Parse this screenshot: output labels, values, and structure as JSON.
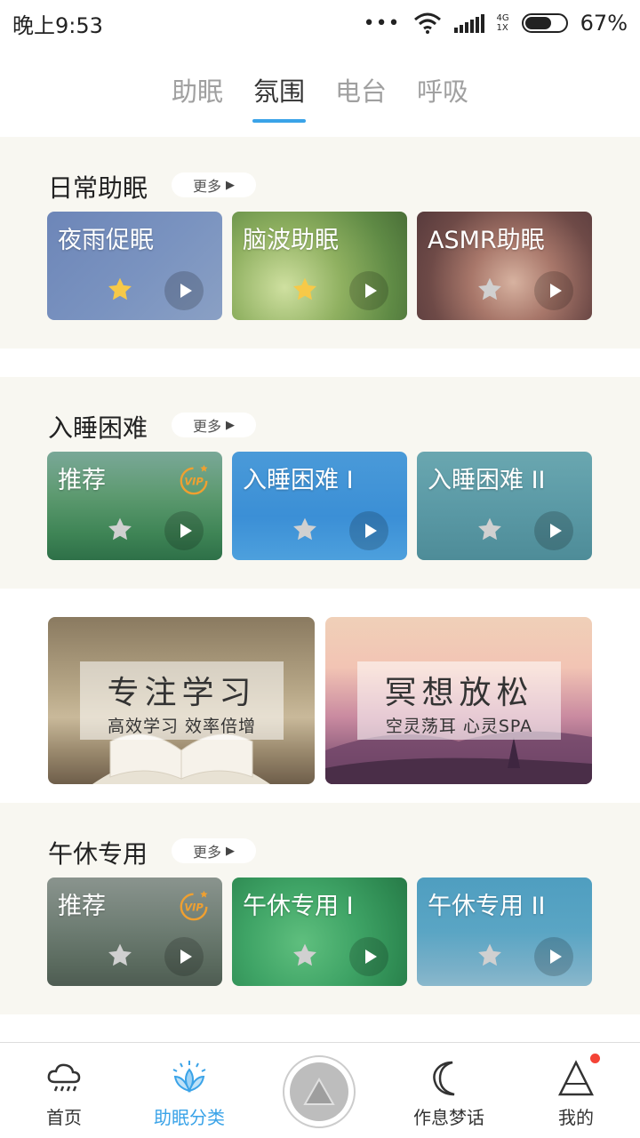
{
  "status_bar": {
    "time": "晚上9:53",
    "dots": "•••",
    "net_top": "4G",
    "net_bottom": "1X",
    "battery": "67%",
    "battery_level": 0.67
  },
  "tabs": [
    {
      "label": "助眠",
      "active": false
    },
    {
      "label": "氛围",
      "active": true
    },
    {
      "label": "电台",
      "active": false
    },
    {
      "label": "呼吸",
      "active": false
    }
  ],
  "more_label": "更多",
  "sections": [
    {
      "title": "日常助眠",
      "cards": [
        {
          "label": "夜雨促眠",
          "starred": true,
          "vip": false
        },
        {
          "label": "脑波助眠",
          "starred": true,
          "vip": false
        },
        {
          "label": "ASMR助眠",
          "starred": false,
          "vip": false
        }
      ]
    },
    {
      "title": "入睡困难",
      "cards": [
        {
          "label": "推荐",
          "starred": false,
          "vip": true
        },
        {
          "label": "入睡困难 I",
          "starred": false,
          "vip": false
        },
        {
          "label": "入睡困难 II",
          "starred": false,
          "vip": false
        }
      ]
    },
    {
      "title": "午休专用",
      "cards": [
        {
          "label": "推荐",
          "starred": false,
          "vip": true
        },
        {
          "label": "午休专用 I",
          "starred": false,
          "vip": false
        },
        {
          "label": "午休专用 II",
          "starred": false,
          "vip": false
        }
      ]
    }
  ],
  "banners": [
    {
      "title": "专注学习",
      "subtitle": "高效学习 效率倍增"
    },
    {
      "title": "冥想放松",
      "subtitle": "空灵荡耳 心灵SPA"
    }
  ],
  "bottom_nav": [
    {
      "label": "首页",
      "icon": "cloud-rain-icon",
      "active": false
    },
    {
      "label": "助眠分类",
      "icon": "lotus-icon",
      "active": true
    },
    {
      "label": "作息梦话",
      "icon": "moon-icon",
      "active": false
    },
    {
      "label": "我的",
      "icon": "mountain-icon",
      "active": false,
      "badge": true
    }
  ],
  "colors": {
    "accent": "#3aa3e8",
    "star_active": "#f7c948",
    "star_inactive": "#d0d0d0",
    "vip": "#f0a030",
    "section_bg": "#f8f7f1",
    "badge": "#f44336"
  }
}
